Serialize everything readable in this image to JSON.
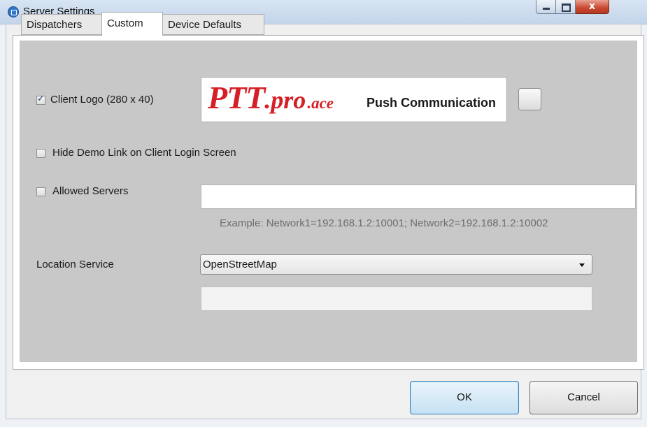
{
  "window": {
    "title": "Server Settings",
    "icon": "app-icon",
    "caption_buttons": {
      "minimize_icon": "minimize-icon",
      "maximize_icon": "maximize-icon",
      "close_label": "x"
    }
  },
  "tabs": [
    {
      "label": "Dispatchers",
      "active": false
    },
    {
      "label": "Custom",
      "active": true
    },
    {
      "label": "Device Defaults",
      "active": false
    }
  ],
  "custom": {
    "client_logo": {
      "label": "Client Logo (280 x 40)",
      "checked": true,
      "logo": {
        "ptt": "PTT",
        "dot": ".",
        "pro": "pro",
        "ace": ".ace",
        "tagline": "Push Communication",
        "brand_color": "#d51f26"
      }
    },
    "hide_demo_link": {
      "label": "Hide Demo Link on Client Login Screen",
      "checked": false
    },
    "allowed_servers": {
      "label": "Allowed Servers",
      "checked": false,
      "value": "",
      "hint": "Example: Network1=192.168.1.2:10001; Network2=192.168.1.2:10002"
    },
    "location_service": {
      "label": "Location Service",
      "selected": "OpenStreetMap",
      "extra_value": ""
    }
  },
  "buttons": {
    "ok": "OK",
    "cancel": "Cancel"
  },
  "colors": {
    "titlebar": "#c9d9ec",
    "panel_gray": "#c8c8c8",
    "close_red": "#c8472f",
    "default_button": "#c6e1f3"
  }
}
